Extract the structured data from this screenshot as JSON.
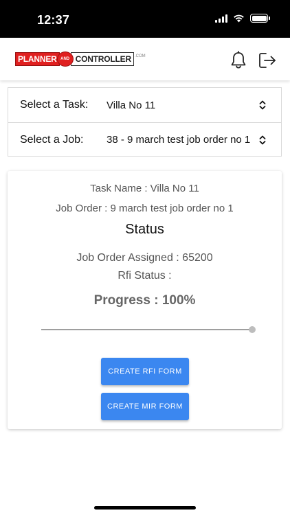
{
  "status_bar": {
    "time": "12:37"
  },
  "header": {
    "logo": {
      "part1": "PLANNER",
      "part2": "AND",
      "part3": "CONTROLLER",
      "suffix": ".COM"
    },
    "icons": [
      "bell-icon",
      "logout-icon"
    ]
  },
  "selectors": {
    "task": {
      "label": "Select a Task:",
      "value": "Villa No 11"
    },
    "job": {
      "label": "Select a Job:",
      "value": "38 - 9 march test job order no 1"
    }
  },
  "card": {
    "task_name": "Task Name : Villa No 11",
    "job_order": "Job Order : 9 march test job order no 1",
    "status_title": "Status",
    "job_order_assigned": "Job Order Assigned : 65200",
    "rfi_status": "Rfi Status :",
    "progress_label": "Progress : 100%",
    "progress_value": 100,
    "buttons": {
      "create_rfi": "CREATE RFI FORM",
      "create_mir": "CREATE MIR FORM"
    }
  },
  "colors": {
    "primary_button": "#3b87f0",
    "logo_red": "#e02020"
  }
}
